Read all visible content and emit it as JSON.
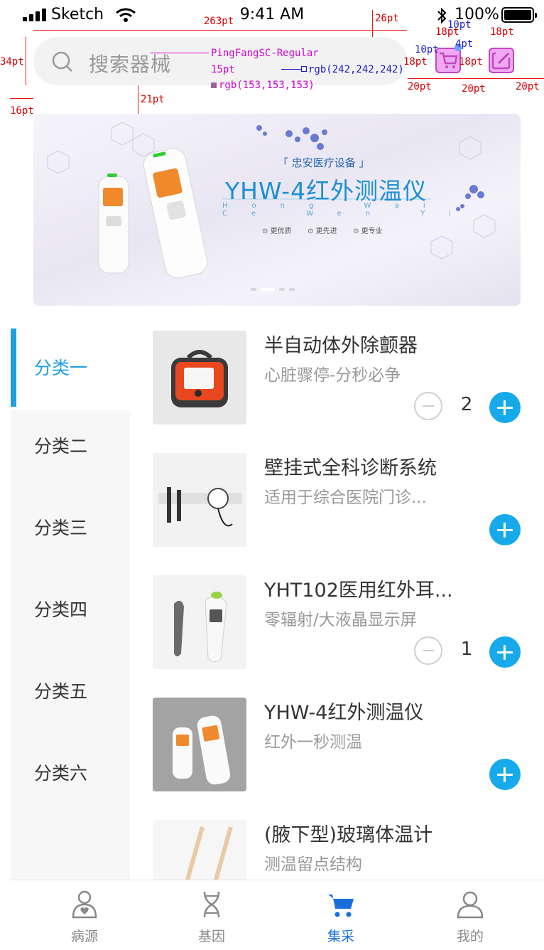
{
  "status_bar": {
    "carrier": "Sketch",
    "time": "9:41 AM",
    "battery": "100%"
  },
  "search": {
    "placeholder": "搜索器械"
  },
  "banner": {
    "subtitle": "「 忠安医疗设备 」",
    "title": "YHW-4红外测温仪",
    "pinyin": "Hong Wai Ce Wen Yi",
    "features": [
      "更优质",
      "更先进",
      "更专业"
    ]
  },
  "categories": [
    {
      "label": "分类一",
      "active": true
    },
    {
      "label": "分类二",
      "active": false
    },
    {
      "label": "分类三",
      "active": false
    },
    {
      "label": "分类四",
      "active": false
    },
    {
      "label": "分类五",
      "active": false
    },
    {
      "label": "分类六",
      "active": false
    }
  ],
  "products": [
    {
      "name": "半自动体外除颤器",
      "desc": "心脏骤停-分秒必争",
      "qty": "2",
      "image": "defibrillator-image"
    },
    {
      "name": "壁挂式全科诊断系统",
      "desc": "适用于综合医院门诊...",
      "qty": "",
      "image": "diagnostic-system-image"
    },
    {
      "name": "YHT102医用红外耳...",
      "desc": "零辐射/大液晶显示屏",
      "qty": "1",
      "image": "ear-thermometer-image"
    },
    {
      "name": "YHW-4红外测温仪",
      "desc": "红外一秒测温",
      "qty": "",
      "image": "infrared-thermometer-image"
    },
    {
      "name": "(腋下型)玻璃体温计",
      "desc": "测温留点结构",
      "qty": "",
      "image": "glass-thermometer-image"
    }
  ],
  "tabs": [
    {
      "label": "病源",
      "icon": "person-heart-icon",
      "active": false
    },
    {
      "label": "基因",
      "icon": "dna-icon",
      "active": false
    },
    {
      "label": "集采",
      "icon": "cart-icon",
      "active": true
    },
    {
      "label": "我的",
      "icon": "user-icon",
      "active": false
    }
  ],
  "annotations": {
    "w263": "263pt",
    "w26": "26pt",
    "h34": "34pt",
    "w16": "16pt",
    "h21": "21pt",
    "font_name": "PingFangSC-Regular",
    "font_size": "15pt",
    "bg_color": "rgb(242,242,242)",
    "text_color": "rgb(153,153,153)",
    "pt18": "18pt",
    "pt10": "10pt",
    "pt4": "4pt",
    "pt20": "20pt"
  },
  "colors": {
    "accent": "#1ea0e0",
    "plus": "#16aaeb",
    "tab_active": "#1a6fdc",
    "search_bg": "#f2f2f2",
    "placeholder": "#999999"
  }
}
